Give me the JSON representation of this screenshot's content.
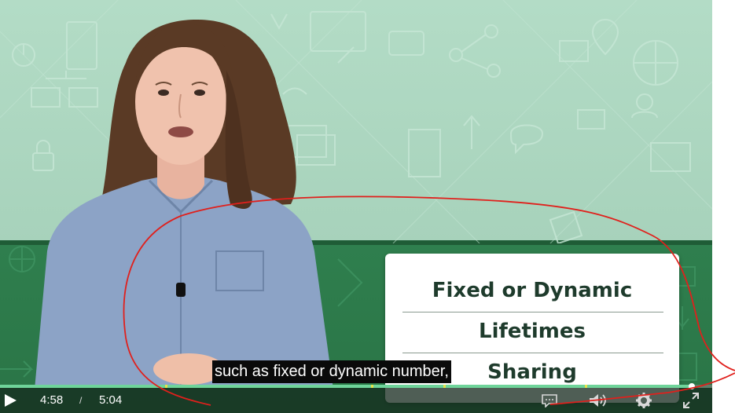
{
  "slide_card": {
    "items": [
      "Fixed or Dynamic",
      "Lifetimes",
      "Sharing"
    ]
  },
  "caption": {
    "text": "such as fixed or dynamic number,"
  },
  "player": {
    "current_time": "4:58",
    "separator": "/",
    "total_time": "5:04",
    "progress_fraction": 0.97,
    "accent_color": "#6fd49a",
    "chapter_mark_color": "#e6e24a"
  },
  "controls": {
    "icons": [
      "play-icon",
      "captions-icon",
      "volume-icon",
      "settings-gear-icon",
      "fullscreen-icon"
    ]
  },
  "annotation": {
    "color": "#e0201c"
  }
}
